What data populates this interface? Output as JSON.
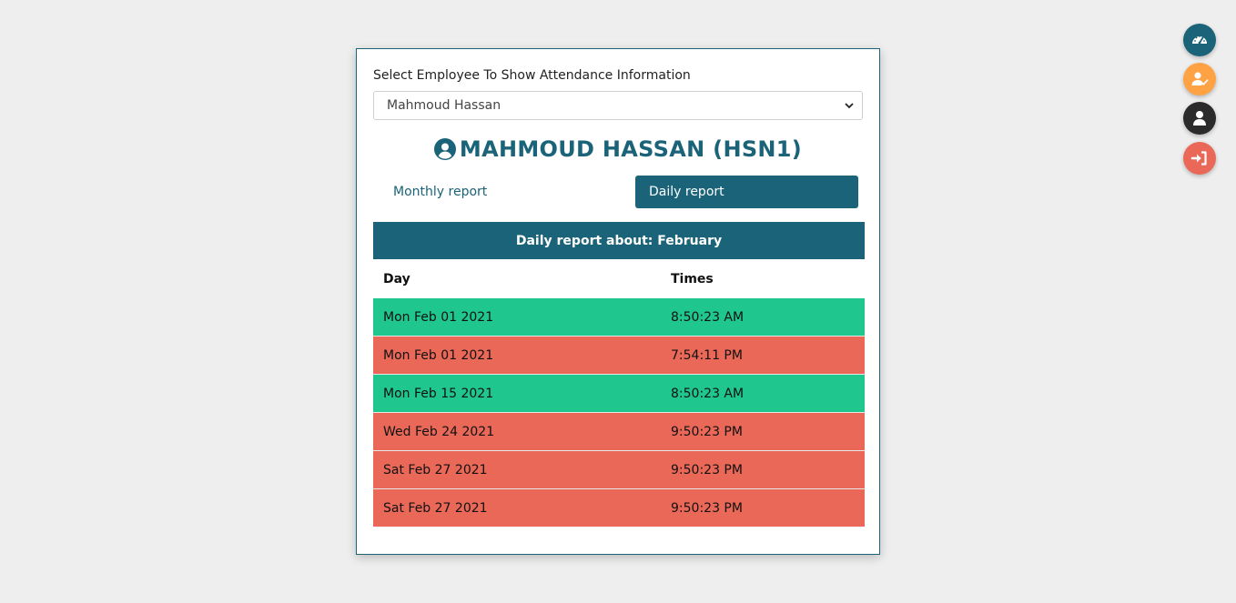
{
  "selector": {
    "label": "Select Employee To Show Attendance Information",
    "selected": "Mahmoud Hassan"
  },
  "employee": {
    "title": "MAHMOUD HASSAN (HSN1)"
  },
  "tabs": {
    "monthly": "Monthly report",
    "daily": "Daily report"
  },
  "report": {
    "header": "Daily report about: February",
    "columns": [
      "Day",
      "Times"
    ],
    "rows": [
      {
        "day": "Mon Feb 01 2021",
        "time": "8:50:23 AM",
        "status": "in"
      },
      {
        "day": "Mon Feb 01 2021",
        "time": "7:54:11 PM",
        "status": "out"
      },
      {
        "day": "Mon Feb 15 2021",
        "time": "8:50:23 AM",
        "status": "in"
      },
      {
        "day": "Wed Feb 24 2021",
        "time": "9:50:23 PM",
        "status": "out"
      },
      {
        "day": "Sat Feb 27 2021",
        "time": "9:50:23 PM",
        "status": "out"
      },
      {
        "day": "Sat Feb 27 2021",
        "time": "9:50:23 PM",
        "status": "out"
      }
    ]
  },
  "colors": {
    "primary": "#1a6379",
    "in": "#1fc78f",
    "out": "#ea6857",
    "fab_dashboard": "#1a6379",
    "fab_attendance": "#fea244",
    "fab_profile": "#2b2b2b",
    "fab_logout": "#ea6857"
  },
  "fabs": [
    {
      "name": "dashboard-icon"
    },
    {
      "name": "user-check-icon"
    },
    {
      "name": "user-icon"
    },
    {
      "name": "sign-in-icon"
    }
  ]
}
